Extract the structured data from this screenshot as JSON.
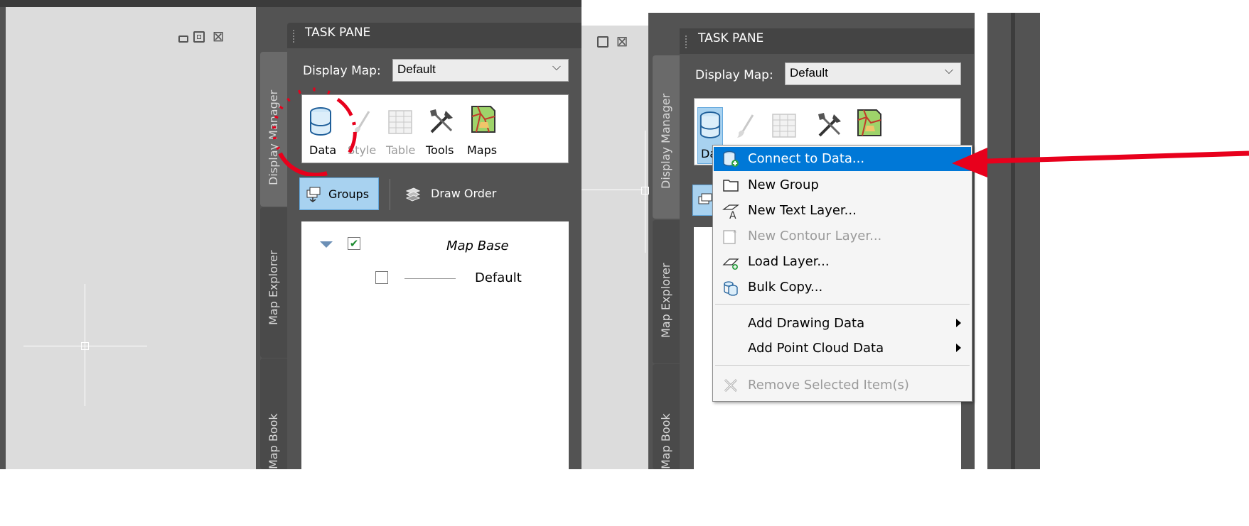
{
  "left": {
    "taskpane_title": "TASK PANE",
    "display_map_label": "Display Map:",
    "display_map_value": "Default",
    "ribbon": [
      {
        "label": "Data",
        "icon": "database-icon"
      },
      {
        "label": "Style",
        "icon": "brush-icon"
      },
      {
        "label": "Table",
        "icon": "table-icon"
      },
      {
        "label": "Tools",
        "icon": "tools-icon"
      },
      {
        "label": "Maps",
        "icon": "map-icon"
      }
    ],
    "groups_label": "Groups",
    "draw_order_label": "Draw Order",
    "tree": {
      "root_label": "Map Base",
      "child_label": "Default"
    },
    "vtabs": [
      "Display Manager",
      "Map Explorer",
      "Map Book"
    ]
  },
  "right": {
    "taskpane_title": "TASK PANE",
    "display_map_label": "Display Map:",
    "display_map_value": "Default",
    "vtabs": [
      "Display Manager",
      "Map Explorer",
      "Map Book"
    ],
    "ribbon_partial_label": "Da",
    "context_menu": [
      {
        "label": "Connect to Data...",
        "icon": "connect-data-icon",
        "highlighted": true
      },
      {
        "label": "New Group",
        "icon": "folder-icon"
      },
      {
        "label": "New Text Layer...",
        "icon": "text-layer-icon"
      },
      {
        "label": "New Contour Layer...",
        "icon": "contour-layer-icon",
        "disabled": true
      },
      {
        "label": "Load Layer...",
        "icon": "load-layer-icon"
      },
      {
        "label": "Bulk Copy...",
        "icon": "bulk-copy-icon"
      },
      {
        "label": "Add Drawing Data",
        "submenu": true
      },
      {
        "label": "Add Point Cloud Data",
        "submenu": true
      },
      {
        "label": "Remove Selected Item(s)",
        "icon": "remove-icon",
        "disabled": true
      }
    ]
  },
  "colors": {
    "dark_panel": "#535353",
    "darker_bar": "#3b3b3b",
    "canvas": "#dcdcdc",
    "highlight": "#0078d7",
    "annotation_red": "#e8001c"
  }
}
